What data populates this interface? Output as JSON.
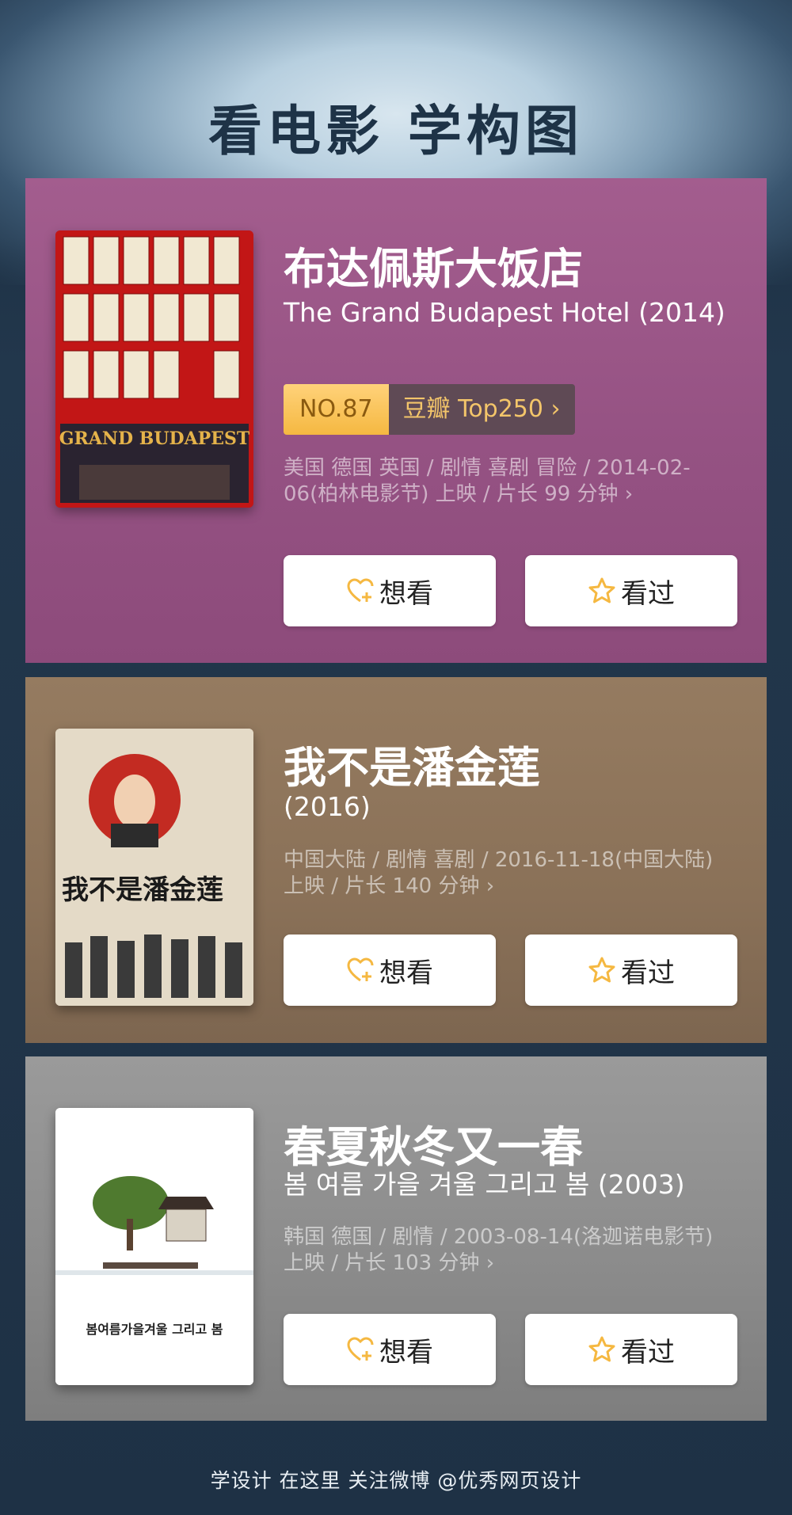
{
  "header": {
    "title": "看电影 学构图"
  },
  "movies": [
    {
      "title_cn": "布达佩斯大饭店",
      "title_orig": "The Grand Budapest Hotel (2014)",
      "rank_no": "NO.87",
      "rank_list": "豆瓣 Top250 ›",
      "meta": "美国 德国 英国 / 剧情 喜剧 冒险 / 2014-02-06(柏林电影节) 上映 / 片长 99 分钟 ›",
      "want_label": "想看",
      "seen_label": "看过",
      "poster_text": "GRAND BUDAPEST"
    },
    {
      "title_cn": "我不是潘金莲",
      "title_orig": " (2016)",
      "meta": "中国大陆 / 剧情 喜剧 / 2016-11-18(中国大陆) 上映 / 片长 140 分钟 ›",
      "want_label": "想看",
      "seen_label": "看过",
      "poster_text": "我不是潘金莲"
    },
    {
      "title_cn": "春夏秋冬又一春",
      "title_orig": "봄 여름 가을 겨울 그리고 봄 (2003)",
      "meta": "韩国 德国 / 剧情 / 2003-08-14(洛迦诺电影节) 上映 / 片长 103 分钟 ›",
      "want_label": "想看",
      "seen_label": "看过",
      "poster_text": "봄여름가을겨울 그리고 봄"
    }
  ],
  "footer": {
    "text": "学设计 在这里    关注微博 @优秀网页设计"
  },
  "colors": {
    "card1": "#9b5788",
    "card2": "#8d7459",
    "card3": "#8d8d8d",
    "accent": "#f5b841"
  }
}
